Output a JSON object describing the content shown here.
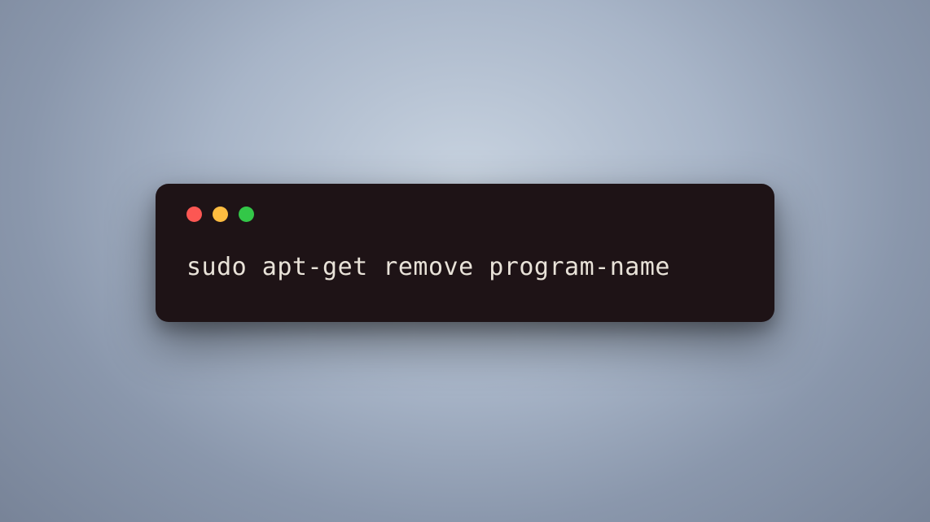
{
  "terminal": {
    "command": "sudo apt-get remove program-name",
    "traffic_lights": {
      "close": "close",
      "minimize": "minimize",
      "maximize": "maximize"
    }
  },
  "colors": {
    "terminal_bg": "#1e1316",
    "terminal_text": "#e8e2d8",
    "close": "#fc5753",
    "minimize": "#fdbc40",
    "maximize": "#33c748"
  }
}
